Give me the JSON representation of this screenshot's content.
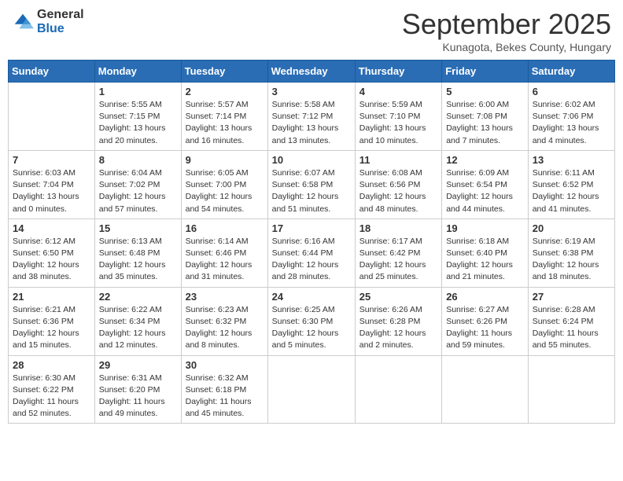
{
  "logo": {
    "general": "General",
    "blue": "Blue"
  },
  "header": {
    "month": "September 2025",
    "location": "Kunagota, Bekes County, Hungary"
  },
  "days_of_week": [
    "Sunday",
    "Monday",
    "Tuesday",
    "Wednesday",
    "Thursday",
    "Friday",
    "Saturday"
  ],
  "weeks": [
    [
      {
        "day": "",
        "info": ""
      },
      {
        "day": "1",
        "info": "Sunrise: 5:55 AM\nSunset: 7:15 PM\nDaylight: 13 hours\nand 20 minutes."
      },
      {
        "day": "2",
        "info": "Sunrise: 5:57 AM\nSunset: 7:14 PM\nDaylight: 13 hours\nand 16 minutes."
      },
      {
        "day": "3",
        "info": "Sunrise: 5:58 AM\nSunset: 7:12 PM\nDaylight: 13 hours\nand 13 minutes."
      },
      {
        "day": "4",
        "info": "Sunrise: 5:59 AM\nSunset: 7:10 PM\nDaylight: 13 hours\nand 10 minutes."
      },
      {
        "day": "5",
        "info": "Sunrise: 6:00 AM\nSunset: 7:08 PM\nDaylight: 13 hours\nand 7 minutes."
      },
      {
        "day": "6",
        "info": "Sunrise: 6:02 AM\nSunset: 7:06 PM\nDaylight: 13 hours\nand 4 minutes."
      }
    ],
    [
      {
        "day": "7",
        "info": "Sunrise: 6:03 AM\nSunset: 7:04 PM\nDaylight: 13 hours\nand 0 minutes."
      },
      {
        "day": "8",
        "info": "Sunrise: 6:04 AM\nSunset: 7:02 PM\nDaylight: 12 hours\nand 57 minutes."
      },
      {
        "day": "9",
        "info": "Sunrise: 6:05 AM\nSunset: 7:00 PM\nDaylight: 12 hours\nand 54 minutes."
      },
      {
        "day": "10",
        "info": "Sunrise: 6:07 AM\nSunset: 6:58 PM\nDaylight: 12 hours\nand 51 minutes."
      },
      {
        "day": "11",
        "info": "Sunrise: 6:08 AM\nSunset: 6:56 PM\nDaylight: 12 hours\nand 48 minutes."
      },
      {
        "day": "12",
        "info": "Sunrise: 6:09 AM\nSunset: 6:54 PM\nDaylight: 12 hours\nand 44 minutes."
      },
      {
        "day": "13",
        "info": "Sunrise: 6:11 AM\nSunset: 6:52 PM\nDaylight: 12 hours\nand 41 minutes."
      }
    ],
    [
      {
        "day": "14",
        "info": "Sunrise: 6:12 AM\nSunset: 6:50 PM\nDaylight: 12 hours\nand 38 minutes."
      },
      {
        "day": "15",
        "info": "Sunrise: 6:13 AM\nSunset: 6:48 PM\nDaylight: 12 hours\nand 35 minutes."
      },
      {
        "day": "16",
        "info": "Sunrise: 6:14 AM\nSunset: 6:46 PM\nDaylight: 12 hours\nand 31 minutes."
      },
      {
        "day": "17",
        "info": "Sunrise: 6:16 AM\nSunset: 6:44 PM\nDaylight: 12 hours\nand 28 minutes."
      },
      {
        "day": "18",
        "info": "Sunrise: 6:17 AM\nSunset: 6:42 PM\nDaylight: 12 hours\nand 25 minutes."
      },
      {
        "day": "19",
        "info": "Sunrise: 6:18 AM\nSunset: 6:40 PM\nDaylight: 12 hours\nand 21 minutes."
      },
      {
        "day": "20",
        "info": "Sunrise: 6:19 AM\nSunset: 6:38 PM\nDaylight: 12 hours\nand 18 minutes."
      }
    ],
    [
      {
        "day": "21",
        "info": "Sunrise: 6:21 AM\nSunset: 6:36 PM\nDaylight: 12 hours\nand 15 minutes."
      },
      {
        "day": "22",
        "info": "Sunrise: 6:22 AM\nSunset: 6:34 PM\nDaylight: 12 hours\nand 12 minutes."
      },
      {
        "day": "23",
        "info": "Sunrise: 6:23 AM\nSunset: 6:32 PM\nDaylight: 12 hours\nand 8 minutes."
      },
      {
        "day": "24",
        "info": "Sunrise: 6:25 AM\nSunset: 6:30 PM\nDaylight: 12 hours\nand 5 minutes."
      },
      {
        "day": "25",
        "info": "Sunrise: 6:26 AM\nSunset: 6:28 PM\nDaylight: 12 hours\nand 2 minutes."
      },
      {
        "day": "26",
        "info": "Sunrise: 6:27 AM\nSunset: 6:26 PM\nDaylight: 11 hours\nand 59 minutes."
      },
      {
        "day": "27",
        "info": "Sunrise: 6:28 AM\nSunset: 6:24 PM\nDaylight: 11 hours\nand 55 minutes."
      }
    ],
    [
      {
        "day": "28",
        "info": "Sunrise: 6:30 AM\nSunset: 6:22 PM\nDaylight: 11 hours\nand 52 minutes."
      },
      {
        "day": "29",
        "info": "Sunrise: 6:31 AM\nSunset: 6:20 PM\nDaylight: 11 hours\nand 49 minutes."
      },
      {
        "day": "30",
        "info": "Sunrise: 6:32 AM\nSunset: 6:18 PM\nDaylight: 11 hours\nand 45 minutes."
      },
      {
        "day": "",
        "info": ""
      },
      {
        "day": "",
        "info": ""
      },
      {
        "day": "",
        "info": ""
      },
      {
        "day": "",
        "info": ""
      }
    ]
  ]
}
